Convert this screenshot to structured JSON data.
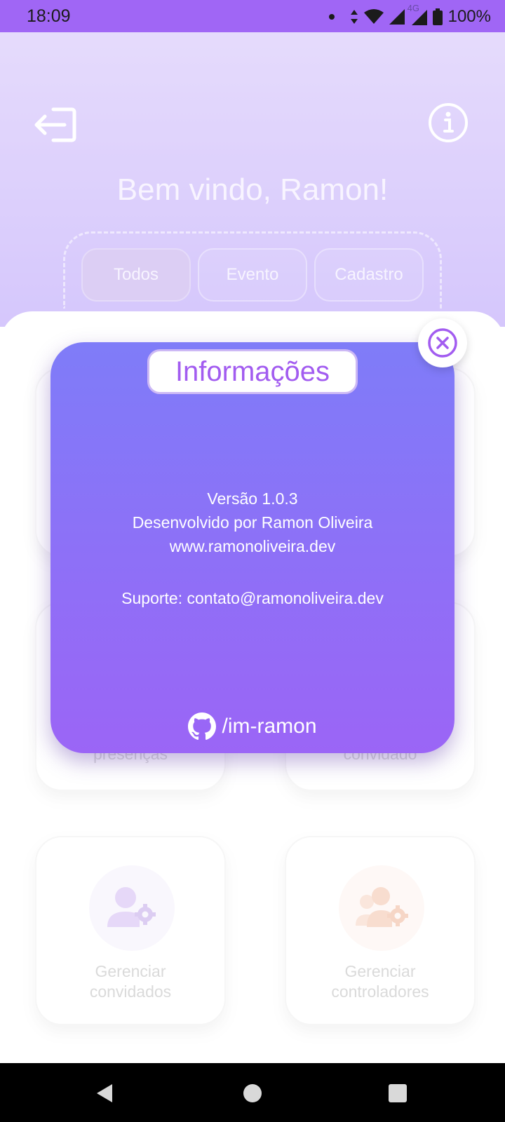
{
  "status_bar": {
    "time": "18:09",
    "battery": "100%",
    "network": "4G",
    "icons": [
      "notification-dot-icon",
      "data-arrows-icon",
      "wifi-icon",
      "signal-icon",
      "signal-4g-icon",
      "battery-icon"
    ]
  },
  "header": {
    "welcome": "Bem vindo, Ramon!",
    "exit_icon": "logout-icon",
    "info_icon": "info-icon"
  },
  "filters": {
    "items": [
      {
        "label": "Todos",
        "active": true
      },
      {
        "label": "Evento",
        "active": false
      },
      {
        "label": "Cadastro",
        "active": false
      }
    ]
  },
  "cards": {
    "partial_left": "presenças",
    "partial_right": "convidado",
    "manage_guests": "Gerenciar convidados",
    "manage_guests_line1": "Gerenciar",
    "manage_guests_line2": "convidados",
    "manage_controllers_line1": "Gerenciar",
    "manage_controllers_line2": "controladores",
    "manage_guests_icon": "user-gear-icon",
    "manage_controllers_icon": "users-gear-icon"
  },
  "modal": {
    "title": "Informações",
    "version": "Versão 1.0.3",
    "developer": "Desenvolvido por Ramon Oliveira",
    "website": "www.ramonoliveira.dev",
    "support": "Suporte: contato@ramonoliveira.dev",
    "github": "/im-ramon",
    "close_icon": "close-circle-icon",
    "github_icon": "github-icon"
  },
  "colors": {
    "accent": "#a066f5",
    "modal_top": "#7f7cf8",
    "modal_bottom": "#9b65f6",
    "title_text": "#a25cf0"
  }
}
